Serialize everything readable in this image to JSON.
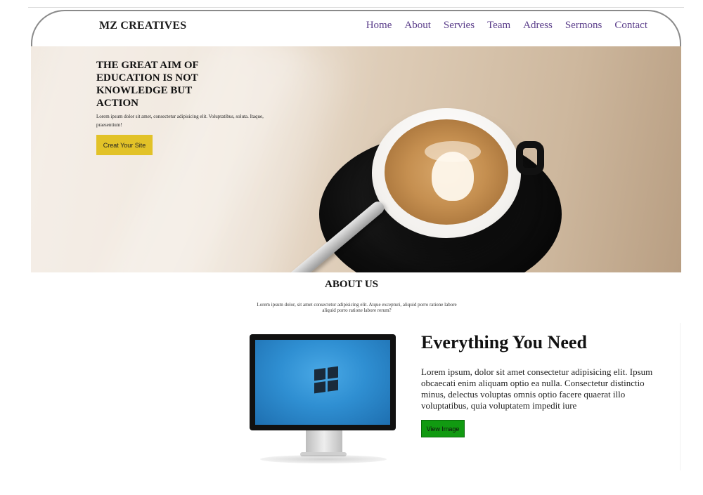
{
  "header": {
    "brand": "MZ CREATIVES",
    "nav": [
      "Home",
      "About",
      "Servies",
      "Team",
      "Adress",
      "Sermons",
      "Contact"
    ]
  },
  "hero": {
    "title": "THE GREAT AIM OF EDUCATION IS NOT KNOWLEDGE BUT ACTION",
    "text": "Lorem ipsum dolor sit amet, consectetur adipisicing elit. Voluptatibus, soluta. Itaque, praesentium!",
    "button": "Creat Your Site"
  },
  "about": {
    "title": "ABOUT US",
    "text": "Lorem ipsum dolor, sit amet consectetur adipisicing elit. Atque excepturi, aliquid porro ratione labore aliquid porro ratione labore rerum?"
  },
  "feature": {
    "title": "Everything You Need",
    "text": "Lorem ipsum, dolor sit amet consectetur adipisicing elit. Ipsum obcaecati enim aliquam optio ea nulla. Consectetur distinctio minus, delectus voluptas omnis optio facere quaerat illo voluptatibus, quia voluptatem impedit iure",
    "button": "View Image"
  },
  "colors": {
    "nav_link": "#5a3d8a",
    "hero_button": "#e2c228",
    "feature_button": "#119a11"
  }
}
